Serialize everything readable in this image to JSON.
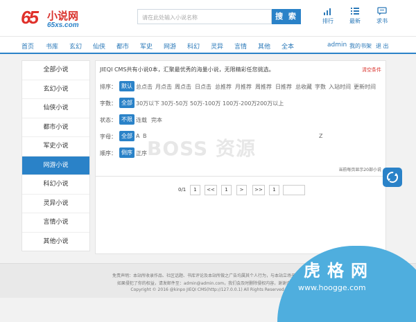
{
  "logo": {
    "big": "65",
    "cn": "小说网",
    "domain": "65xs.com"
  },
  "search": {
    "placeholder": "请在此处输入小说名称",
    "button": "搜 索"
  },
  "top_icons": [
    {
      "label": "排行",
      "icon": "bar-chart-icon"
    },
    {
      "label": "最新",
      "icon": "list-icon"
    },
    {
      "label": "求书",
      "icon": "chat-icon"
    }
  ],
  "nav": {
    "items": [
      "首页",
      "书库",
      "玄幻",
      "仙侠",
      "都市",
      "军史",
      "网游",
      "科幻",
      "灵异",
      "言情",
      "其他",
      "全本"
    ],
    "user": "admin",
    "bookshelf": "我的书架",
    "logout": "退 出"
  },
  "sidebar": {
    "items": [
      "全部小说",
      "玄幻小说",
      "仙侠小说",
      "都市小说",
      "军史小说",
      "网游小说",
      "科幻小说",
      "灵异小说",
      "言情小说",
      "其他小说"
    ],
    "active_index": 5
  },
  "main": {
    "announce": "JIEQI CMS共有小说0本，汇聚最优秀的海量小说，无限精彩任您挑选。",
    "clear": "清空条件",
    "sort": {
      "label": "排序：",
      "options": [
        "默认",
        "总点击",
        "月点击",
        "周点击",
        "日点击",
        "总推荐",
        "月推荐",
        "周推荐",
        "日推荐",
        "总收藏",
        "字数",
        "入站时间",
        "更新时间"
      ]
    },
    "words": {
      "label": "字数：",
      "options": [
        "全部",
        "30万以下",
        "30万-50万",
        "50万-100万",
        "100万-200万",
        "200万以上"
      ]
    },
    "status": {
      "label": "状态：",
      "options": [
        "不限",
        "连载",
        "完本"
      ]
    },
    "letter": {
      "label": "字母：",
      "options": [
        "全部",
        "A",
        "B",
        "Z"
      ]
    },
    "order": {
      "label": "顺序：",
      "options": [
        "倒序",
        "正序"
      ]
    },
    "perpage": "当前每页显示20部小说"
  },
  "pagination": {
    "info": "0/1",
    "buttons": [
      "1",
      "<<",
      "1",
      ">",
      ">>",
      "1"
    ]
  },
  "watermark": "BOSS 资源",
  "footer": {
    "line1": "免责声明：本站所收录作品、社区话题、书库评论及本站所做之广告均属其个人行为，与本站立场无关。",
    "line2": "如果侵犯了你的权益，请发邮件至：admin@admin.com，我们会及时删除侵权内容，谢谢合作！",
    "line3": "Copyright © 2016 @kinpo JIEQI CMS(http://127.0.0.1) All Rights Reserved."
  },
  "brand_badge": {
    "cn": "虎格网",
    "url": "www.hoogge.com"
  },
  "colors": {
    "accent": "#2a82c8",
    "logo_red": "#e0302a",
    "badge": "#4faede"
  }
}
